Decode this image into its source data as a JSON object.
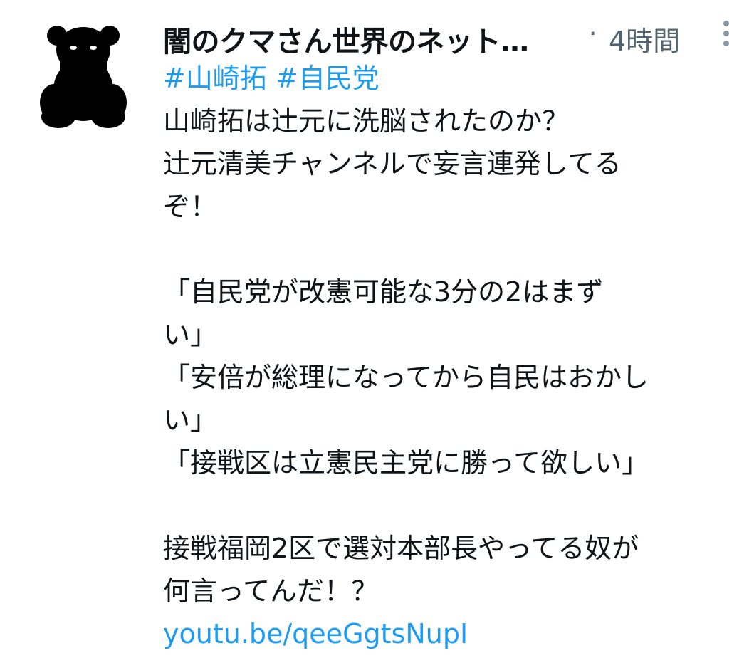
{
  "tweet": {
    "author_name": "闇のクマさん世界のネット…",
    "separator": "·",
    "time": "4時間",
    "hashtags": [
      "#山崎拓",
      "#自民党"
    ],
    "body_text": "山崎拓は辻元に洗脳されたのか？\n辻元清美チャンネルで妄言連発してる\nぞ！\n\n「自民党が改憲可能な3分の2はまず\nい」\n「安倍が総理になってから自民はおかし\nい」\n「接戦区は立憲民主党に勝って欲しい」\n\n接戦福岡2区で選対本部長やってる奴が\n何言ってんだ！？",
    "link_text": "youtu.be/qeeGgtsNupI"
  },
  "icons": {
    "avatar": "bear-silhouette-icon",
    "more": "more-vertical-icon"
  },
  "colors": {
    "accent": "#1d9bf0",
    "text": "#0f1419",
    "muted": "#536471",
    "background": "#ffffff"
  }
}
